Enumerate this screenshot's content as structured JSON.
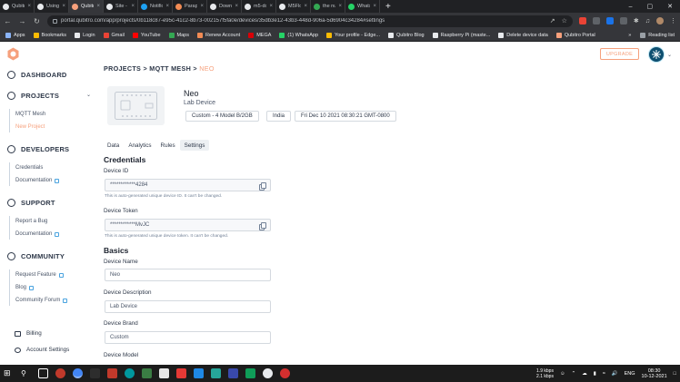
{
  "browser": {
    "tabs": [
      {
        "label": "Qubitro w",
        "color": "#e8eaed",
        "active": false
      },
      {
        "label": "Using the",
        "color": "#e8eaed",
        "active": false
      },
      {
        "label": "Qubitro P",
        "color": "#f6a07c",
        "active": true
      },
      {
        "label": "Site - Qui",
        "color": "#e8eaed",
        "active": false
      },
      {
        "label": "Notificati",
        "color": "#1da1f2",
        "active": false
      },
      {
        "label": "Paraphras",
        "color": "#f28b54",
        "active": false
      },
      {
        "label": "Downloa",
        "color": "#e8eaed",
        "active": false
      },
      {
        "label": "m5-docs",
        "color": "#e8eaed",
        "active": false
      },
      {
        "label": "M5Flow",
        "color": "#e8eaed",
        "active": false
      },
      {
        "label": "the numbe",
        "color": "#34a853",
        "active": false
      },
      {
        "label": "WhatsApp",
        "color": "#25d366",
        "active": false
      }
    ],
    "new_tab": "+",
    "url": "portal.qubitro.com/app/projects/0b118c87-e95c-41c2-8b73-002157f5fa0e/devices/35db3e12-43b3-448d-906a-5d6904c34284#settings",
    "bookmarks": [
      {
        "label": "Apps",
        "color": "#8ab4f8"
      },
      {
        "label": "Bookmarks",
        "color": "#fbbc04"
      },
      {
        "label": "Login",
        "color": "#e8eaed"
      },
      {
        "label": "Gmail",
        "color": "#ea4335"
      },
      {
        "label": "YouTube",
        "color": "#ff0000"
      },
      {
        "label": "Maps",
        "color": "#34a853"
      },
      {
        "label": "Renew Account",
        "color": "#f28b54"
      },
      {
        "label": "MEGA",
        "color": "#d90007"
      },
      {
        "label": "(1) WhatsApp",
        "color": "#25d366"
      },
      {
        "label": "Your profile - Edge...",
        "color": "#fbbc04"
      },
      {
        "label": "Qubitro Blog",
        "color": "#e8eaed"
      },
      {
        "label": "Raspberry Pi (maste...",
        "color": "#e8eaed"
      },
      {
        "label": "Delete device data",
        "color": "#e8eaed"
      },
      {
        "label": "Qubitro Portal",
        "color": "#f6a07c"
      }
    ],
    "bookmarks_more": "»",
    "reading_list": "Reading list"
  },
  "sidebar": {
    "dashboard": "DASHBOARD",
    "projects": "PROJECTS",
    "project_items": [
      "MQTT Mesh",
      "New Project"
    ],
    "developers": "DEVELOPERS",
    "developer_items": [
      "Credentials",
      "Documentation"
    ],
    "support": "SUPPORT",
    "support_items": [
      "Report a Bug",
      "Documentation"
    ],
    "community": "COMMUNITY",
    "community_items": [
      "Request Feature",
      "Blog",
      "Community Forum"
    ],
    "billing": "Billing",
    "account_settings": "Account Settings"
  },
  "header": {
    "breadcrumb_projects": "PROJECTS",
    "breadcrumb_sep": ">",
    "breadcrumb_project": "MQTT MESH",
    "breadcrumb_device": "NEO",
    "upgrade": "UPGRADE"
  },
  "device": {
    "name": "Neo",
    "type": "Lab Device",
    "chips": [
      "Custom - 4 Model B/2GB",
      "India",
      "Fri Dec 10 2021 08:30:21 GMT-0800"
    ]
  },
  "tabs": [
    "Data",
    "Analytics",
    "Rules",
    "Settings"
  ],
  "credentials": {
    "title": "Credentials",
    "device_id_label": "Device ID",
    "device_id_value": "************4284",
    "device_id_help": "This is auto-generated unique device ID. It can't be changed.",
    "device_token_label": "Device Token",
    "device_token_value": "************MvJC",
    "device_token_help": "This is auto-generated unique device token. It can't be changed."
  },
  "basics": {
    "title": "Basics",
    "name_label": "Device Name",
    "name_value": "Neo",
    "description_label": "Device Description",
    "description_value": "Lab Device",
    "brand_label": "Device Brand",
    "brand_value": "Custom",
    "model_label": "Device Model"
  },
  "taskbar": {
    "net_up": "1.9 kbps",
    "net_down": "2.1 kbps",
    "lang": "ENG",
    "time": "08:30",
    "date": "10-12-2021"
  },
  "colors": {
    "accent": "#f6a07c",
    "link": "#4aa3df",
    "text": "#2d3748"
  }
}
